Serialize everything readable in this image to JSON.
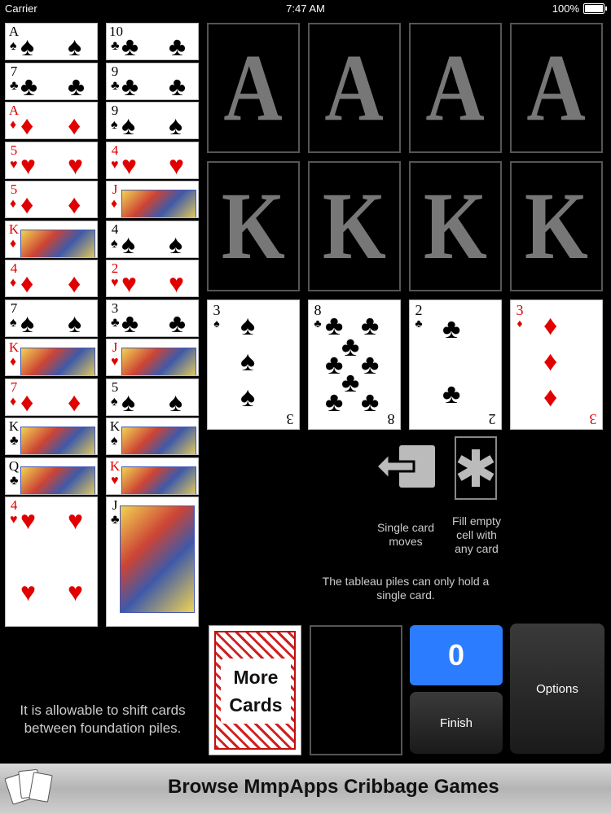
{
  "status": {
    "carrier": "Carrier",
    "time": "7:47 AM",
    "battery": "100%"
  },
  "columns": [
    [
      {
        "rank": "A",
        "suit": "♠",
        "color": "blk"
      },
      {
        "rank": "7",
        "suit": "♣",
        "color": "blk"
      },
      {
        "rank": "A",
        "suit": "♦",
        "color": "red"
      },
      {
        "rank": "5",
        "suit": "♥",
        "color": "red"
      },
      {
        "rank": "5",
        "suit": "♦",
        "color": "red"
      },
      {
        "rank": "K",
        "suit": "♦",
        "color": "red"
      },
      {
        "rank": "4",
        "suit": "♦",
        "color": "red"
      },
      {
        "rank": "7",
        "suit": "♠",
        "color": "blk"
      },
      {
        "rank": "K",
        "suit": "♦",
        "color": "red"
      },
      {
        "rank": "7",
        "suit": "♦",
        "color": "red"
      },
      {
        "rank": "K",
        "suit": "♣",
        "color": "blk"
      },
      {
        "rank": "Q",
        "suit": "♣",
        "color": "blk"
      },
      {
        "rank": "4",
        "suit": "♥",
        "color": "red"
      }
    ],
    [
      {
        "rank": "10",
        "suit": "♣",
        "color": "blk"
      },
      {
        "rank": "9",
        "suit": "♣",
        "color": "blk"
      },
      {
        "rank": "9",
        "suit": "♠",
        "color": "blk"
      },
      {
        "rank": "4",
        "suit": "♥",
        "color": "red"
      },
      {
        "rank": "J",
        "suit": "♦",
        "color": "red"
      },
      {
        "rank": "4",
        "suit": "♠",
        "color": "blk"
      },
      {
        "rank": "2",
        "suit": "♥",
        "color": "red"
      },
      {
        "rank": "3",
        "suit": "♣",
        "color": "blk"
      },
      {
        "rank": "J",
        "suit": "♥",
        "color": "red"
      },
      {
        "rank": "5",
        "suit": "♠",
        "color": "blk"
      },
      {
        "rank": "K",
        "suit": "♠",
        "color": "blk"
      },
      {
        "rank": "K",
        "suit": "♥",
        "color": "red"
      },
      {
        "rank": "J",
        "suit": "♣",
        "color": "blk"
      }
    ]
  ],
  "foundation_top": [
    "A",
    "A",
    "A",
    "A"
  ],
  "foundation_bottom": [
    "K",
    "K",
    "K",
    "K"
  ],
  "tableau": [
    {
      "rank": "3",
      "suit": "♠",
      "color": "blk"
    },
    {
      "rank": "8",
      "suit": "♣",
      "color": "blk"
    },
    {
      "rank": "2",
      "suit": "♣",
      "color": "blk"
    },
    {
      "rank": "3",
      "suit": "♦",
      "color": "red"
    }
  ],
  "rules": {
    "single_card_caption_1": "Single card",
    "single_card_caption_2": "moves",
    "fill_caption_1": "Fill empty",
    "fill_caption_2": "cell with",
    "fill_caption_3": "any card",
    "tableau_note_1": "The tableau piles can only hold a",
    "tableau_note_2": "single card."
  },
  "deck": {
    "line1": "More",
    "line2": "Cards"
  },
  "score": "0",
  "buttons": {
    "finish": "Finish",
    "options": "Options"
  },
  "hint": {
    "line1": "It is allowable to shift cards",
    "line2": "between foundation piles."
  },
  "banner": {
    "text": "Browse MmpApps Cribbage Games"
  }
}
